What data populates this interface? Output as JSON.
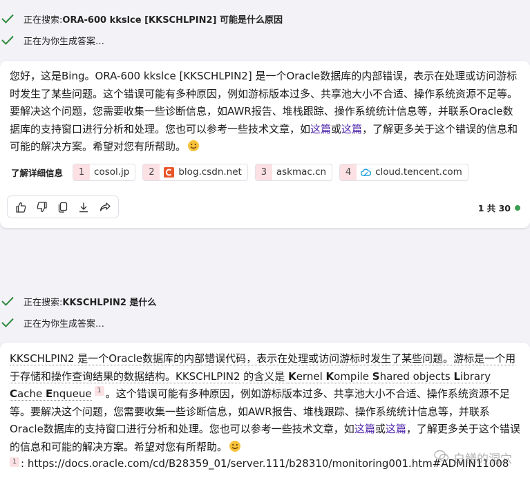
{
  "chat1": {
    "status_search_prefix": "正在搜索: ",
    "status_search_query": "ORA-600 kkslce [KKSCHLPIN2] 可能是什么原因",
    "status_generating": "正在为你生成答案…",
    "answer": {
      "text_1": "您好，这是Bing。ORA-600 kkslce [KKSCHLPIN2] 是一个Oracle数据库的内部错误，表示在处理或访问游标时发生了某些问题。这个错误可能有多种原因，例如游标版本过多、共享池大小不合适、操作系统资源不足等。要解决这个问题，您需要收集一些诊断信息，如AWR报告、堆栈跟踪、操作系统统计信息等，并联系Oracle数据库的支持窗口进行分析和处理。您也可以参考一些技术文章，如",
      "link_1": "这篇",
      "text_or": "或",
      "link_2": "这篇",
      "text_2": "，了解更多关于这个错误的信息和可能的解决方案。希望对您有所帮助。"
    },
    "learn_more_label": "了解详细信息",
    "sources": [
      {
        "num": "1",
        "domain": "cosol.jp",
        "icon": "none"
      },
      {
        "num": "2",
        "domain": "blog.csdn.net",
        "icon": "csdn-c-icon"
      },
      {
        "num": "3",
        "domain": "askmac.cn",
        "icon": "none"
      },
      {
        "num": "4",
        "domain": "cloud.tencent.com",
        "icon": "tencent-cloud-icon"
      }
    ],
    "actions": [
      "thumbs-up-icon",
      "thumbs-down-icon",
      "copy-icon",
      "download-icon",
      "share-icon"
    ],
    "page_count": "1 共 30",
    "status_dot_color": "#3a9d4f"
  },
  "chat2": {
    "status_search_prefix": "正在搜索: ",
    "status_search_query": "KKSCHLPIN2 是什么",
    "status_generating": "正在为你生成答案…",
    "answer": {
      "text_1": "KKSCHLPIN2 是一个Oracle数据库的内部错误代码，表示在处理或访问游标时发生了某些问题。游标是一个用于存储和操作查询结果的数据结构。KKSCHLPIN2 的含义是 ",
      "k1": "K",
      "w1": "ernel ",
      "k2": "K",
      "w2": "ompile ",
      "k3": "S",
      "w3": "hared objects ",
      "k4": "L",
      "w4": "ibrary ",
      "k5": "C",
      "w5": "ache ",
      "k6": "E",
      "w6": "nqueue",
      "ref": "1",
      "text_2": "。这个错误可能有多种原因，例如游标版本过多、共享池大小不合适、操作系统资源不足等。要解决这个问题，您需要收集一些诊断信息，如AWR报告、堆栈跟踪、操作系统统计信息等，并联系Oracle数据库的支持窗口进行分析和处理。您也可以参考一些技术文章，如",
      "link_1": "这篇",
      "text_or": "或",
      "link_2": "这篇",
      "text_3": "，了解更多关于这个错误的信息和可能的解决方案。希望对您有所帮助。"
    },
    "footnote_num": "1",
    "footnote_text": ": https://docs.oracle.com/cd/B28359_01/server.111/b28310/monitoring001.htm#ADMIN11008"
  },
  "watermark": "白鳝的洞穴",
  "colors": {
    "check_green": "#2f8a3c",
    "link_purple": "#4a1fa8",
    "badge_pink": "#fbe1e4"
  }
}
